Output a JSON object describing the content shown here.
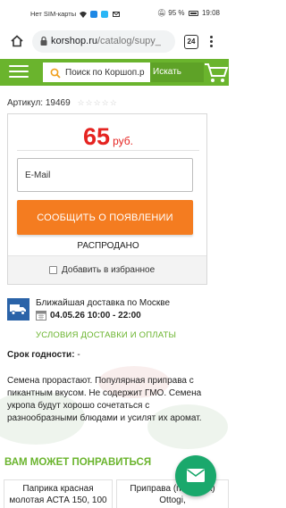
{
  "statusbar": {
    "carrier": "Нет SIM-карты",
    "battery": "95 %",
    "time": "19:08"
  },
  "browser": {
    "url_host": "korshop.ru",
    "url_path": "/catalog/supy_",
    "tab_count": "24"
  },
  "site": {
    "search_placeholder": "Поиск по Коршоп.р",
    "search_button": "Искать",
    "brand_color": "#6ab42d"
  },
  "product": {
    "article": "Артикул: 19469",
    "stars": "☆☆☆☆☆",
    "price": "65",
    "currency": "руб.",
    "email_placeholder": "E-Mail",
    "notify_button": "СООБЩИТЬ О ПОЯВЛЕНИИ",
    "status": "РАСПРОДАНО",
    "favorite_label": "Добавить в избранное",
    "price_color": "#e52421",
    "button_color": "#f47c20"
  },
  "delivery": {
    "title": "Ближайшая доставка по Москве",
    "date": "04.05.26 10:00 - 22:00",
    "link": "УСЛОВИЯ ДОСТАВКИ И ОПЛАТЫ"
  },
  "info": {
    "shelf_label": "Срок годности:",
    "shelf_value": " -",
    "description": "Семена прорастают. Популярная приправа с пикантным вкусом. Не содержит ГМО. Семена укропа будут хорошо сочетаться с разнообразными блюдами и усилят их аромат."
  },
  "recommend": {
    "title": "ВАМ МОЖЕТ ПОНРАВИТЬСЯ",
    "items": [
      {
        "name": "Паприка красная молотая АСТА 150, 100"
      },
      {
        "name": "Приправа (порошок) Ottogi,"
      }
    ]
  }
}
